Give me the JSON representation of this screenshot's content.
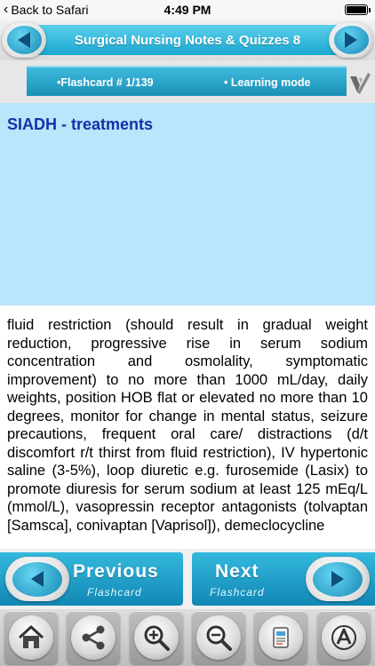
{
  "status_bar": {
    "back_label": "Back to Safari",
    "time": "4:49 PM"
  },
  "header": {
    "title": "Surgical Nursing Notes & Quizzes 8"
  },
  "info": {
    "flashcard": "•Flashcard # 1/139",
    "mode": "• Learning mode"
  },
  "card": {
    "title": "SIADH - treatments",
    "body": "fluid restriction (should result in gradual weight reduction, progressive rise in serum sodium concentration and osmolality, symptomatic improvement) to no more than 1000 mL/day, daily weights, position HOB flat or elevated no more than 10 degrees, monitor for change in mental status, seizure precautions, frequent oral care/ distractions (d/t discomfort r/t thirst from fluid restriction), IV hypertonic saline (3-5%), loop diuretic e.g. furosemide (Lasix) to promote diuresis for serum sodium at least 125 mEq/L (mmol/L), vasopressin receptor antagonists (tolvaptan [Samsca], conivaptan [Vaprisol]), demeclocycline"
  },
  "nav": {
    "previous_main": "Previous",
    "previous_sub": "Flashcard",
    "next_main": "Next",
    "next_sub": "Flashcard"
  },
  "toolbar": {
    "icons": [
      "home-icon",
      "share-icon",
      "zoom-in-icon",
      "zoom-out-icon",
      "notes-icon",
      "text-format-icon"
    ]
  },
  "colors": {
    "accent": "#1ba7cf",
    "title_area": "#b9e6fa",
    "title_text": "#1730a8"
  }
}
